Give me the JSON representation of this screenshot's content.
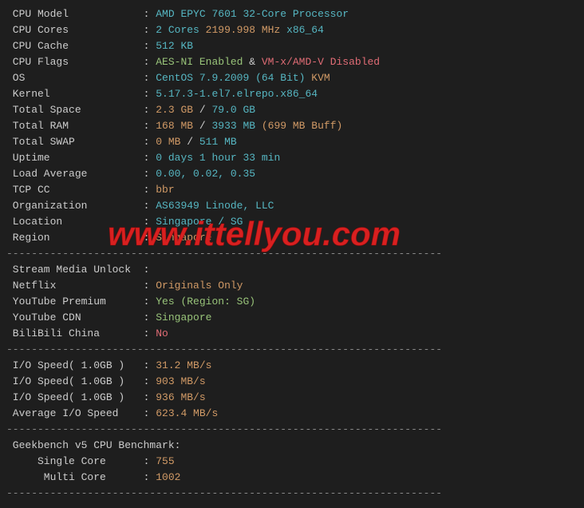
{
  "sys": [
    {
      "label": "CPU Model",
      "parts": [
        {
          "t": "AMD EPYC 7601 32-Core Processor",
          "c": "cyan"
        }
      ]
    },
    {
      "label": "CPU Cores",
      "parts": [
        {
          "t": "2 Cores",
          "c": "cyan"
        },
        {
          "t": " 2199.998 MHz",
          "c": "yellow"
        },
        {
          "t": " x86_64",
          "c": "cyan"
        }
      ]
    },
    {
      "label": "CPU Cache",
      "parts": [
        {
          "t": "512 KB",
          "c": "cyan"
        }
      ]
    },
    {
      "label": "CPU Flags",
      "parts": [
        {
          "t": "AES-NI Enabled",
          "c": "green"
        },
        {
          "t": " & ",
          "c": "white"
        },
        {
          "t": "VM-x/AMD-V Disabled",
          "c": "red"
        }
      ]
    },
    {
      "label": "OS",
      "parts": [
        {
          "t": "CentOS 7.9.2009 (64 Bit)",
          "c": "cyan"
        },
        {
          "t": " KVM",
          "c": "yellow"
        }
      ]
    },
    {
      "label": "Kernel",
      "parts": [
        {
          "t": "5.17.3-1.el7.elrepo.x86_64",
          "c": "cyan"
        }
      ]
    },
    {
      "label": "Total Space",
      "parts": [
        {
          "t": "2.3 GB",
          "c": "yellow"
        },
        {
          "t": " / ",
          "c": "white"
        },
        {
          "t": "79.0 GB",
          "c": "cyan"
        }
      ]
    },
    {
      "label": "Total RAM",
      "parts": [
        {
          "t": "168 MB",
          "c": "yellow"
        },
        {
          "t": " / ",
          "c": "white"
        },
        {
          "t": "3933 MB",
          "c": "cyan"
        },
        {
          "t": " (699 MB Buff)",
          "c": "yellow"
        }
      ]
    },
    {
      "label": "Total SWAP",
      "parts": [
        {
          "t": "0 MB",
          "c": "yellow"
        },
        {
          "t": " / ",
          "c": "white"
        },
        {
          "t": "511 MB",
          "c": "cyan"
        }
      ]
    },
    {
      "label": "Uptime",
      "parts": [
        {
          "t": "0 days 1 hour 33 min",
          "c": "cyan"
        }
      ]
    },
    {
      "label": "Load Average",
      "parts": [
        {
          "t": "0.00, 0.02, 0.35",
          "c": "cyan"
        }
      ]
    },
    {
      "label": "TCP CC",
      "parts": [
        {
          "t": "bbr",
          "c": "yellow"
        }
      ]
    },
    {
      "label": "Organization",
      "parts": [
        {
          "t": "AS63949 Linode, LLC",
          "c": "cyan"
        }
      ]
    },
    {
      "label": "Location",
      "parts": [
        {
          "t": "Singapore / SG",
          "c": "cyan"
        }
      ]
    },
    {
      "label": "Region",
      "parts": [
        {
          "t": "Singapore",
          "c": "yellow"
        }
      ]
    }
  ],
  "stream_header": "Stream Media Unlock",
  "stream": [
    {
      "label": "Netflix",
      "parts": [
        {
          "t": "Originals Only",
          "c": "yellow"
        }
      ]
    },
    {
      "label": "YouTube Premium",
      "parts": [
        {
          "t": "Yes (Region: SG)",
          "c": "green"
        }
      ]
    },
    {
      "label": "YouTube CDN",
      "parts": [
        {
          "t": "Singapore",
          "c": "green"
        }
      ]
    },
    {
      "label": "BiliBili China",
      "parts": [
        {
          "t": "No",
          "c": "red"
        }
      ]
    }
  ],
  "io": [
    {
      "label": "I/O Speed( 1.0GB )",
      "parts": [
        {
          "t": "31.2 MB/s",
          "c": "yellow"
        }
      ]
    },
    {
      "label": "I/O Speed( 1.0GB )",
      "parts": [
        {
          "t": "903 MB/s",
          "c": "yellow"
        }
      ]
    },
    {
      "label": "I/O Speed( 1.0GB )",
      "parts": [
        {
          "t": "936 MB/s",
          "c": "yellow"
        }
      ]
    },
    {
      "label": "Average I/O Speed",
      "parts": [
        {
          "t": "623.4 MB/s",
          "c": "yellow"
        }
      ]
    }
  ],
  "geekbench_header": "Geekbench v5 CPU Benchmark:",
  "geekbench": [
    {
      "label": "Single Core",
      "parts": [
        {
          "t": "755",
          "c": "yellow"
        }
      ]
    },
    {
      "label": "Multi Core",
      "parts": [
        {
          "t": "1002",
          "c": "yellow"
        }
      ]
    }
  ],
  "watermark": "www.ittellyou.com",
  "divider": "----------------------------------------------------------------------"
}
